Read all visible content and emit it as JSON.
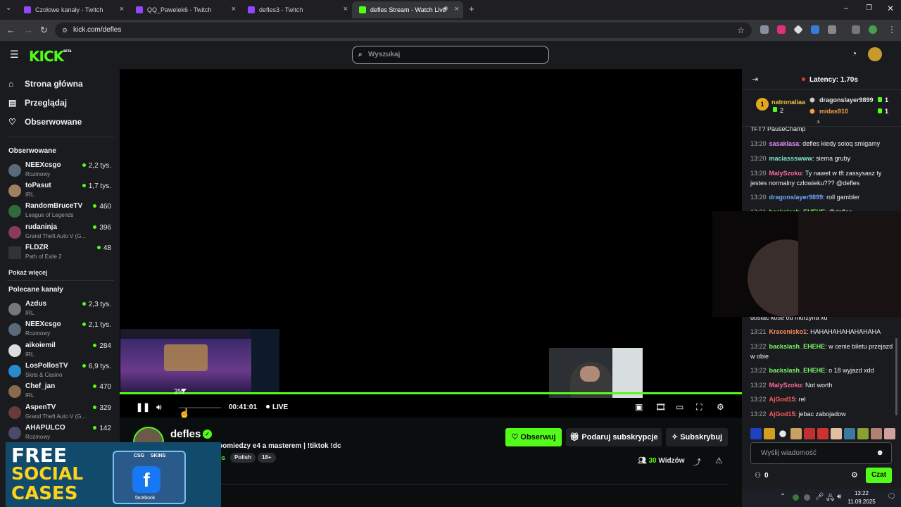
{
  "browser": {
    "tabs": [
      {
        "title": "Czołowe kanały - Twitch",
        "color": "#9146ff"
      },
      {
        "title": "QQ_Pawelek6 - Twitch",
        "color": "#9146ff"
      },
      {
        "title": "defles3 - Twitch",
        "color": "#9146ff"
      },
      {
        "title": "defles Stream - Watch Live o",
        "color": "#53fc18"
      }
    ],
    "url": "kick.com/defles",
    "new_tab_icon": "+"
  },
  "header": {
    "logo": "KICK",
    "logo_badge": "BETA",
    "search_placeholder": "Wyszukaj"
  },
  "sidebar": {
    "nav": [
      {
        "label": "Strona główna",
        "icon": "home-icon"
      },
      {
        "label": "Przeglądaj",
        "icon": "browse-icon"
      },
      {
        "label": "Obserwowane",
        "icon": "heart-icon"
      }
    ],
    "followed_title": "Obserwowane",
    "followed": [
      {
        "name": "NEEXcsgo",
        "category": "Rozmowy",
        "viewers": "2,2 tys.",
        "avatar": "#5a6a7a"
      },
      {
        "name": "toPasut",
        "category": "IRL",
        "viewers": "1,7 tys.",
        "avatar": "#a08060"
      },
      {
        "name": "RandomBruceTV",
        "category": "League of Legends",
        "viewers": "460",
        "avatar": "#2f6b3a"
      },
      {
        "name": "rudaninja",
        "category": "Grand Theft Auto V (G...",
        "viewers": "396",
        "avatar": "#8a3a5a"
      },
      {
        "name": "FLDZR",
        "category": "Path of Exile 2",
        "viewers": "48",
        "avatar": "#333333"
      }
    ],
    "show_more": "Pokaż więcej",
    "recommended_title": "Polecane kanały",
    "recommended": [
      {
        "name": "Azdus",
        "category": "IRL",
        "viewers": "2,3 tys.",
        "avatar": "#777777"
      },
      {
        "name": "NEEXcsgo",
        "category": "Rozmowy",
        "viewers": "2,1 tys.",
        "avatar": "#5a6a7a"
      },
      {
        "name": "aikoiemil",
        "category": "IRL",
        "viewers": "284",
        "avatar": "#dddddd"
      },
      {
        "name": "LosPollosTV",
        "category": "Slots & Casino",
        "viewers": "6,9 tys.",
        "avatar": "#2a8ad0"
      },
      {
        "name": "Chef_jan",
        "category": "IRL",
        "viewers": "470",
        "avatar": "#8a6a4a"
      },
      {
        "name": "AspenTV",
        "category": "Grand Theft Auto V (G...",
        "viewers": "329",
        "avatar": "#6a3a3a"
      },
      {
        "name": "AHAPULCO",
        "category": "Rozmowy",
        "viewers": "142",
        "avatar": "#4a4a6a"
      }
    ]
  },
  "player": {
    "progress_label": "3%",
    "timecode": "00:41:01",
    "live_label": "LIVE"
  },
  "stream": {
    "streamer": "defles",
    "title": "pomiedzy e4 a masterem | !tiktok !dc",
    "category_fragment": "cs",
    "tags": [
      "Polish",
      "18+"
    ],
    "follow_label": "Obserwuj",
    "gift_label": "Podaruj subskrypcje",
    "subscribe_label": "Subskrybuj",
    "viewers_count": "30",
    "viewers_label": "Widzów"
  },
  "ad": {
    "line1": "FREE",
    "line2": "SOCIAL",
    "line3": "CASES",
    "box_label": "CSG",
    "box_label2": "SKINS",
    "fb_label": "facebook"
  },
  "chat": {
    "latency": "Latency: 1.70s",
    "top_gifter": {
      "rank": "1",
      "name": "natronaliaa",
      "count": "2"
    },
    "gifters": [
      {
        "name": "dragonslayer9899",
        "count": "1",
        "color": "#e6e6e6"
      },
      {
        "name": "midas910",
        "count": "1",
        "color": "#f0a040"
      }
    ],
    "messages_top": [
      {
        "time": "",
        "user": "",
        "text": "TFT? PauseChamp",
        "color": "#f2f2f2"
      },
      {
        "time": "13:20",
        "user": "sasaklasa",
        "text": ": defles kiedy soloq smigamy",
        "color": "#e58cff"
      },
      {
        "time": "13:20",
        "user": "maciassswww",
        "text": ": siema gruby",
        "color": "#7be8c8"
      },
      {
        "time": "13:20",
        "user": "MalySzoku",
        "text": ": Ty nawet w tft zassysasz ty jestes normalny czlowieku??? @defles",
        "color": "#ff6a9a"
      },
      {
        "time": "13:20",
        "user": "dragonslayer9899",
        "text": ": roll gambler",
        "color": "#6ea8ff"
      },
      {
        "time": "13:21",
        "user": "backslash_EHEHE",
        "text": ": @defles",
        "color": "#7cf56a"
      }
    ],
    "messages_bottom": [
      {
        "time": "",
        "user": "",
        "text": "dostac kose od murzyna xd",
        "color": "#f2f2f2"
      },
      {
        "time": "13:21",
        "user": "Kracenisko1",
        "text": ": HAHAHAHAHAHAHAHA",
        "color": "#ff8c5a"
      },
      {
        "time": "13:22",
        "user": "backslash_EHEHE",
        "text": ": w cenie biletu przejazd w obie",
        "color": "#7cf56a"
      },
      {
        "time": "13:22",
        "user": "backslash_EHEHE",
        "text": ": o 18 wyjazd xdd",
        "color": "#7cf56a"
      },
      {
        "time": "13:22",
        "user": "MalySzoku",
        "text": ": Not worth",
        "color": "#ff6a9a"
      },
      {
        "time": "13:22",
        "user": "AjGod15",
        "text": ": rel",
        "color": "#ff5a5a"
      },
      {
        "time": "13:22",
        "user": "AjGod15",
        "text": ": jebac zabojadow",
        "color": "#ff5a5a"
      }
    ],
    "emotes": [
      "#2040c0",
      "#d0a020",
      "#e6e6e6",
      "#c8a060",
      "#c03030",
      "#d03030",
      "#e0c0a0",
      "#3a7aa0",
      "#8aa030",
      "#b08070",
      "#d0a0a0"
    ],
    "input_placeholder": "Wyślij wiadomość",
    "points": "0",
    "send_label": "Czat"
  },
  "taskbar": {
    "time": "13:22",
    "date": "11.09.2025"
  },
  "colors": {
    "accent": "#53fc18",
    "bg": "#0b0e0f",
    "panel": "#191b1f"
  }
}
